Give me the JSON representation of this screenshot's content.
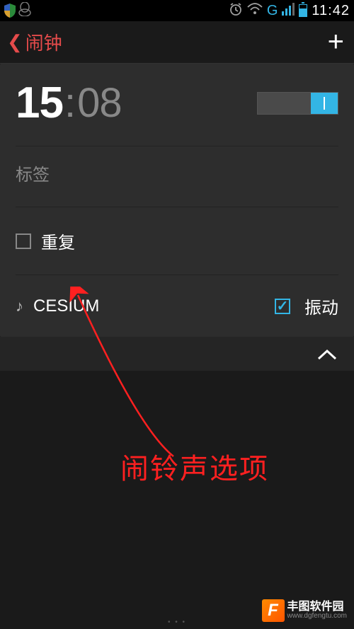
{
  "status": {
    "network_letter": "G",
    "time": "11:42"
  },
  "header": {
    "title": "闹钟"
  },
  "alarm": {
    "hour": "15",
    "minute": "08",
    "label_placeholder": "标签",
    "repeat_label": "重复",
    "ringtone_name": "CESIUM",
    "vibrate_label": "振动"
  },
  "annotation": {
    "text": "闹铃声选项"
  },
  "watermark": {
    "logo_letter": "F",
    "name": "丰图软件园",
    "url": "www.dgfengtu.com"
  }
}
